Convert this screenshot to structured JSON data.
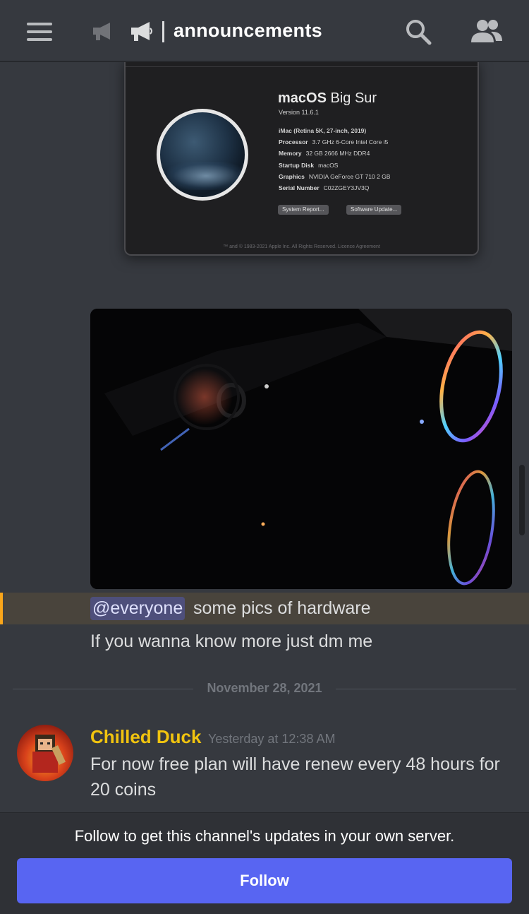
{
  "header": {
    "menu_icon": "hamburger-menu-icon",
    "channel_icon": "megaphone-icon",
    "channel_name": "announcements",
    "search_icon": "search-icon",
    "members_icon": "members-icon"
  },
  "mac_screenshot": {
    "os_name_bold": "macOS",
    "os_name_light": "Big Sur",
    "version": "Version 11.6.1",
    "model": "iMac (Retina 5K, 27-inch, 2019)",
    "specs": [
      {
        "key": "Processor",
        "value": "3.7 GHz 6-Core Intel Core i5"
      },
      {
        "key": "Memory",
        "value": "32 GB 2666 MHz DDR4"
      },
      {
        "key": "Startup Disk",
        "value": "macOS"
      },
      {
        "key": "Graphics",
        "value": "NVIDIA GeForce GT 710 2 GB"
      },
      {
        "key": "Serial Number",
        "value": "C02ZGEY3JV3Q"
      }
    ],
    "buttons": [
      "System Report...",
      "Software Update..."
    ],
    "footer": "™ and © 1983-2021 Apple Inc. All Rights Reserved. Licence Agreement"
  },
  "messages": {
    "mention": "@everyone",
    "line1": "some pics of hardware",
    "line2": "If you wanna know more just dm me",
    "date_divider": "November 28, 2021",
    "author": "Chilled Duck",
    "timestamp": "Yesterday at 12:38 AM",
    "line3": "For now free plan will have renew every 48 hours for 20 coins"
  },
  "footer": {
    "hint": "Follow to get this channel's updates in your own server.",
    "follow_label": "Follow"
  },
  "colors": {
    "background": "#36393f",
    "accent": "#5865f2",
    "mention_highlight": "#faa61a",
    "author_color": "#f1c40f"
  }
}
